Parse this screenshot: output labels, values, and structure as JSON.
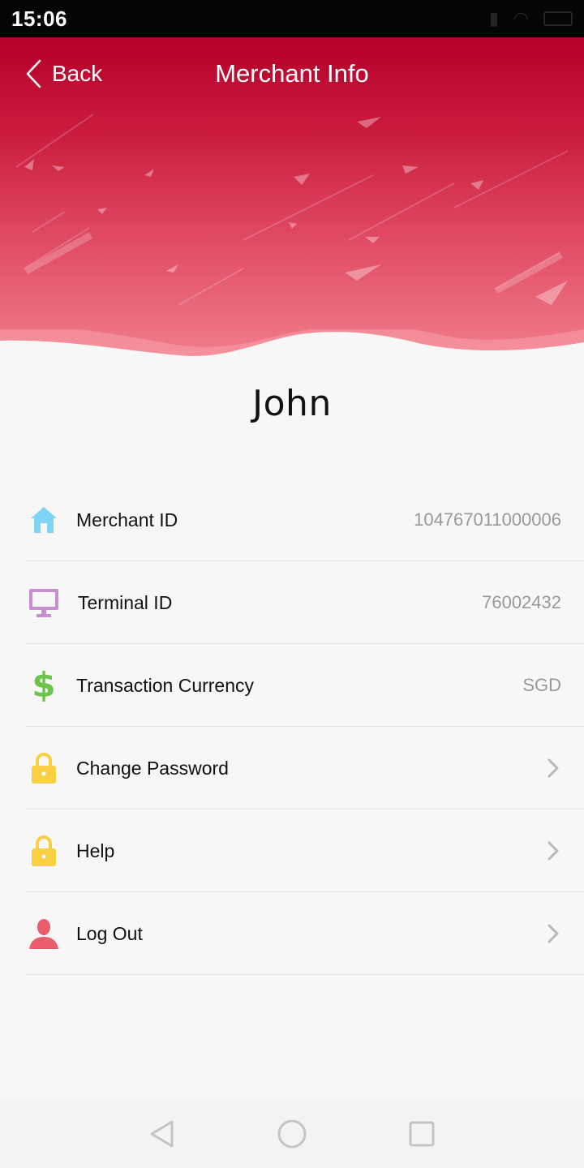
{
  "status_bar": {
    "time": "15:06"
  },
  "header": {
    "back_label": "Back",
    "title": "Merchant Info"
  },
  "profile": {
    "name": "John"
  },
  "menu": {
    "items": [
      {
        "label": "Merchant ID",
        "value": "104767011000006",
        "icon": "home-icon",
        "icon_color": "#7fd3f5"
      },
      {
        "label": "Terminal ID",
        "value": "76002432",
        "icon": "monitor-icon",
        "icon_color": "#c88fd0"
      },
      {
        "label": "Transaction Currency",
        "value": "SGD",
        "icon": "dollar-icon",
        "icon_color": "#6cc44a"
      },
      {
        "label": "Change Password",
        "icon": "lock-icon",
        "icon_color": "#f7d143"
      },
      {
        "label": "Help",
        "icon": "lock-icon",
        "icon_color": "#f7d143"
      },
      {
        "label": "Log Out",
        "icon": "user-icon",
        "icon_color": "#e95d6c"
      }
    ]
  },
  "colors": {
    "brand_red": "#b5002a",
    "value_gray": "#999999",
    "chevron_gray": "#b9b9b9"
  },
  "system_nav": {
    "icons": [
      "back-triangle-icon",
      "home-circle-icon",
      "recents-square-icon"
    ]
  }
}
